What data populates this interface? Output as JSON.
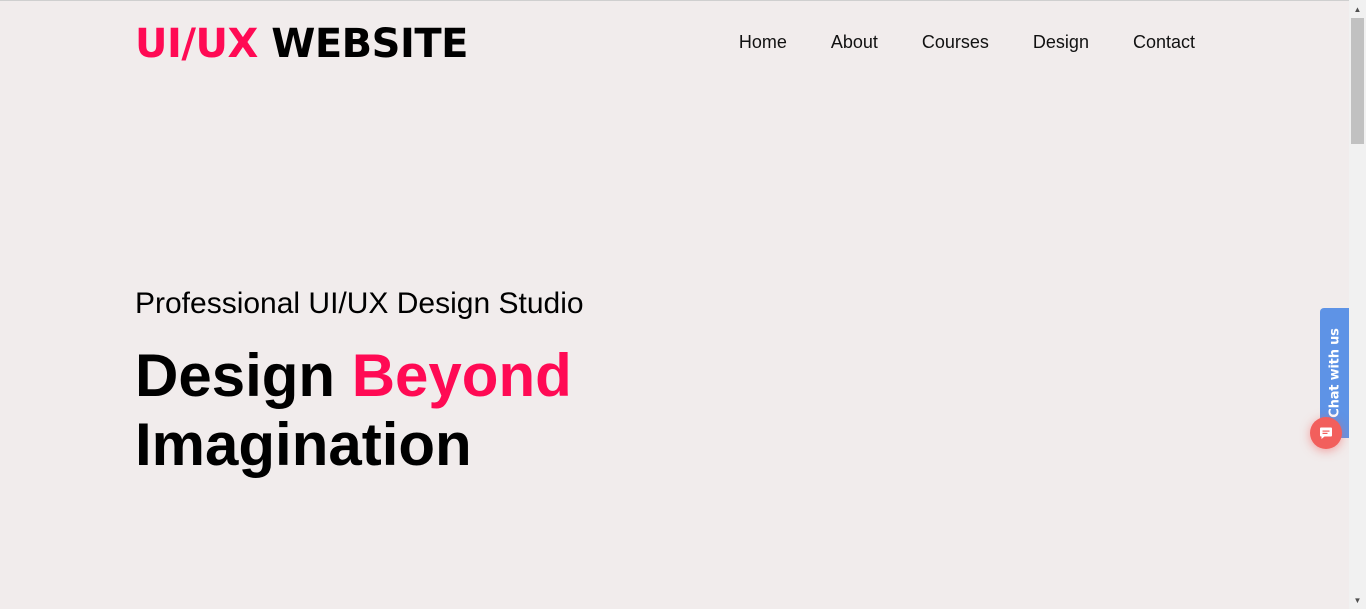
{
  "header": {
    "logo_accent": "UI/UX",
    "logo_main": "WEBSITE",
    "nav": [
      {
        "label": "Home"
      },
      {
        "label": "About"
      },
      {
        "label": "Courses"
      },
      {
        "label": "Design"
      },
      {
        "label": "Contact"
      }
    ]
  },
  "hero": {
    "subtitle": "Professional UI/UX Design Studio",
    "title_part1": "Design ",
    "title_highlight": "Beyond",
    "title_part2": "Imagination"
  },
  "chat": {
    "tab_label": "Chat with us",
    "icon": "chat-bubble-icon"
  },
  "colors": {
    "accent": "#ff0a54",
    "background": "#f1ecec",
    "chat_tab": "#5e93e6",
    "chat_button": "#f25f5c"
  }
}
